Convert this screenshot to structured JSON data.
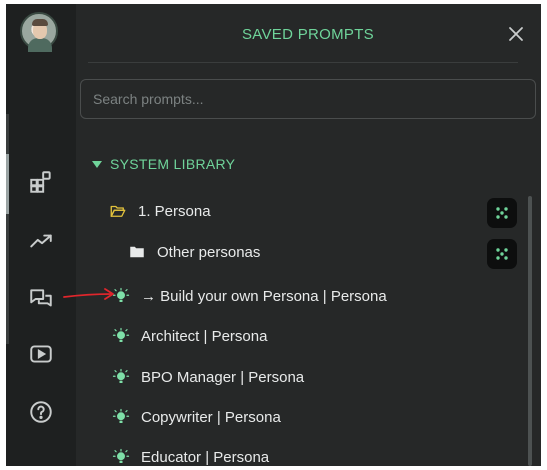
{
  "header": {
    "title": "SAVED PROMPTS"
  },
  "search": {
    "placeholder": "Search prompts..."
  },
  "library": {
    "section_title": "SYSTEM LIBRARY",
    "folder": {
      "label": "1. Persona"
    },
    "subfolder": {
      "label": "Other personas"
    },
    "items": [
      {
        "label": "→ Build your own Persona | Persona"
      },
      {
        "label": "Architect | Persona"
      },
      {
        "label": "BPO Manager | Persona"
      },
      {
        "label": "Copywriter | Persona"
      },
      {
        "label": "Educator | Persona"
      }
    ]
  },
  "icons": {
    "rail": [
      "apps-icon",
      "trending-icon",
      "chat-icon",
      "video-icon",
      "help-icon"
    ],
    "prompt_item": "lightbulb-icon",
    "folder_open": "folder-open-icon",
    "folder": "folder-icon",
    "action": "dots-icon"
  },
  "colors": {
    "accent": "#6fd49a",
    "panel_bg": "#262828",
    "rail_bg": "#1e2020",
    "annotation_arrow": "#e0262c"
  }
}
